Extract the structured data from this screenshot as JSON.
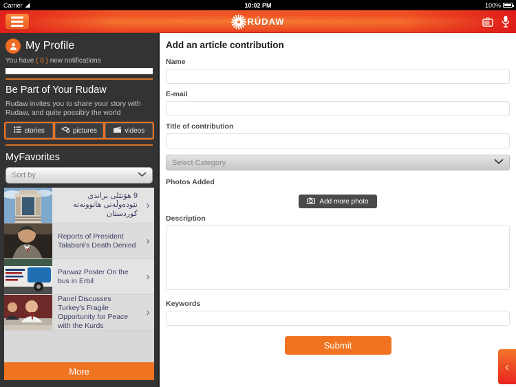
{
  "status_bar": {
    "carrier": "Carrier",
    "wifi_icon": "wifi-icon",
    "time": "10:02 PM",
    "battery_percent": "100%"
  },
  "nav": {
    "menu_icon": "hamburger-menu-icon",
    "logo_text": "RÚDAW",
    "tv_icon": "tv-icon",
    "mic_icon": "microphone-icon"
  },
  "sidebar": {
    "profile_title": "My Profile",
    "profile_icon": "person-icon",
    "notifications_prefix": "You have",
    "notifications_count": "( 0 )",
    "notifications_suffix": "new notifications",
    "section_title": "Be Part of Your Rudaw",
    "blurb": "Rudaw invites you to share your story with Rudaw, and quite possibly the world",
    "chips": [
      {
        "label": "stories",
        "icon": "list-icon"
      },
      {
        "label": "pictures",
        "icon": "photos-icon"
      },
      {
        "label": "videos",
        "icon": "clapperboard-icon"
      }
    ],
    "favorites_title": "MyFavorites",
    "sort_by": {
      "label": "Sort by",
      "icon": "chevron-down-icon"
    },
    "favorites": [
      {
        "title": "9 هۆتێلی براندی نێودەوڵەتی هاتوونەتە کوردستان",
        "rtl": true,
        "thumb": "hotel-building-photo"
      },
      {
        "title": "Reports of President Talabani's Death Denied",
        "rtl": false,
        "thumb": "talabani-portrait-photo"
      },
      {
        "title": "Parwaz Poster On the bus in Erbil",
        "rtl": false,
        "thumb": "bus-poster-photo"
      },
      {
        "title": "Panel Discusses Turkey's Fragile Opportunity for Peace with the Kurds",
        "rtl": false,
        "thumb": "panel-discussion-photo"
      }
    ],
    "more_label": "More"
  },
  "form": {
    "heading": "Add an article contribution",
    "name_label": "Name",
    "name_value": "",
    "email_label": "E-mail",
    "email_value": "",
    "title_label": "Title of contribution",
    "title_value": "",
    "category_placeholder": "Select Category",
    "category_icon": "chevron-down-icon",
    "photos_label": "Photos Added",
    "add_photo_label": "Add more photo",
    "camera_icon": "camera-icon",
    "description_label": "Description",
    "description_value": "",
    "keywords_label": "Keywords",
    "keywords_value": "",
    "submit_label": "Submit"
  },
  "drawer": {
    "icon": "chevron-left-icon"
  },
  "colors": {
    "accent": "#ef7320",
    "brand_red": "#e8241f",
    "sidebar_bg": "#333333",
    "link_text": "#3b3f63"
  }
}
